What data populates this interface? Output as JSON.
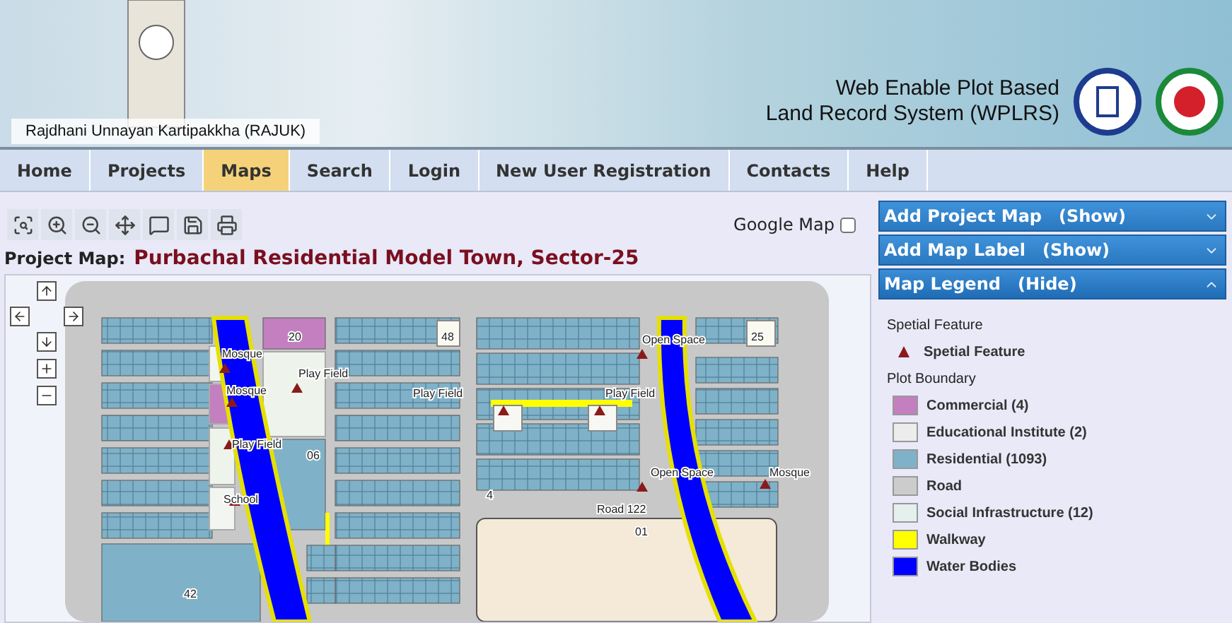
{
  "header": {
    "org": "Rajdhani Unnayan Kartipakkha (RAJUK)",
    "title_lines": [
      "Web Enable Plot Based",
      "Land Record System (WPLRS)"
    ]
  },
  "nav": [
    {
      "label": "Home",
      "selected": false
    },
    {
      "label": "Projects",
      "selected": false
    },
    {
      "label": "Maps",
      "selected": true
    },
    {
      "label": "Search",
      "selected": false
    },
    {
      "label": "Login",
      "selected": false
    },
    {
      "label": "New User Registration",
      "selected": false
    },
    {
      "label": "Contacts",
      "selected": false
    },
    {
      "label": "Help",
      "selected": false
    }
  ],
  "map_panel": {
    "google_map": {
      "label": "Google Map",
      "checked": false
    },
    "title_label": "Project Map:",
    "title": "Purbachal Residential Model Town, Sector-25",
    "map_labels": [
      "20",
      "48",
      "Mosque",
      "Play Field",
      "Mosque",
      "Play Field",
      "06",
      "School",
      "42",
      "Play Field",
      "Play Field",
      "Open Space",
      "25",
      "Open Space",
      "Mosque",
      "4",
      "Road 122",
      "01"
    ]
  },
  "sidebar": {
    "sections": [
      {
        "title": "Add Project Map",
        "toggle": "(Show)",
        "expanded": false
      },
      {
        "title": "Add Map Label",
        "toggle": "(Show)",
        "expanded": false
      },
      {
        "title": "Map Legend",
        "toggle": "(Hide)",
        "expanded": true
      }
    ],
    "legend": [
      {
        "heading": "Spetial Feature",
        "items": [
          {
            "kind": "marker",
            "label": "Spetial Feature",
            "color": "#8b1a1a"
          }
        ]
      },
      {
        "heading": "Plot Boundary",
        "items": [
          {
            "kind": "swatch",
            "label": "Commercial (4)",
            "color": "#c37fc0"
          },
          {
            "kind": "swatch",
            "label": "Educational Institute (2)",
            "color": "#ececec"
          },
          {
            "kind": "swatch",
            "label": "Residential (1093)",
            "color": "#7fb2c8"
          },
          {
            "kind": "swatch",
            "label": "Road",
            "color": "#cccccc"
          },
          {
            "kind": "swatch",
            "label": "Social Infrastructure (12)",
            "color": "#e4efee"
          },
          {
            "kind": "swatch",
            "label": "Walkway",
            "color": "#ffff00"
          },
          {
            "kind": "swatch",
            "label": "Water Bodies",
            "color": "#0000ff"
          }
        ]
      }
    ]
  }
}
